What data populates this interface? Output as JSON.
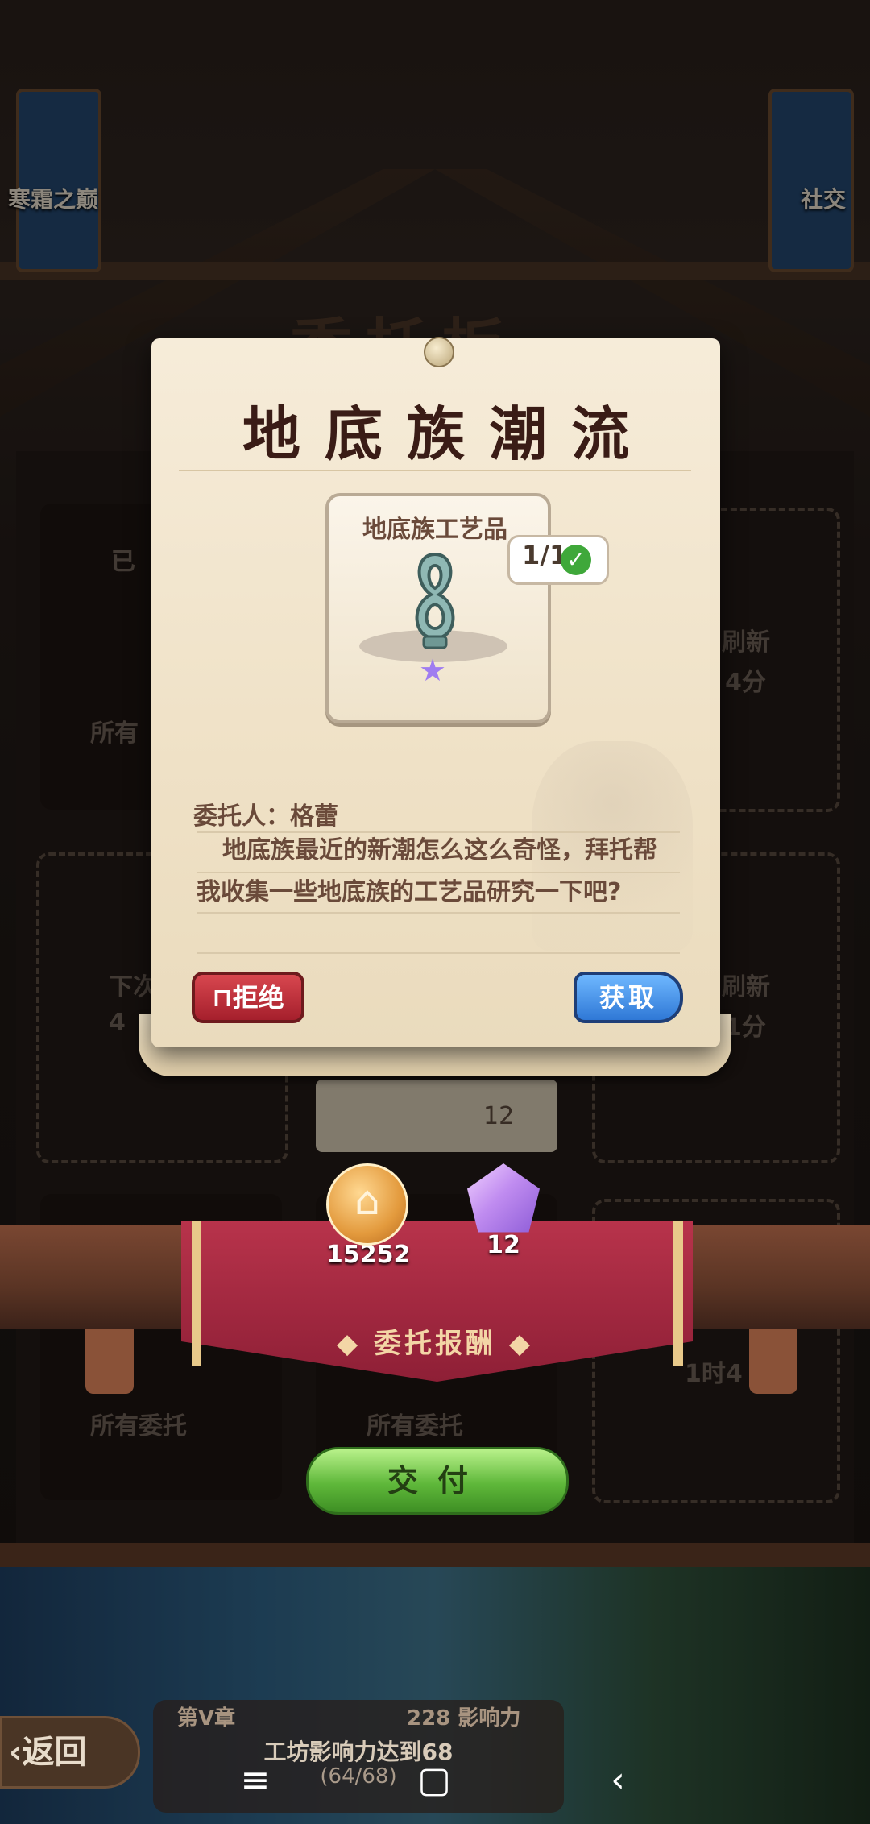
{
  "background": {
    "left_banner": "寒霜之巅",
    "right_banner": "社交",
    "title_partial": "委托板",
    "slot_texts": [
      "已",
      "所有",
      "刷新",
      "4分",
      "下次",
      "4",
      "刷新",
      "1分",
      "1时4",
      "所有委托",
      "所有委托"
    ],
    "card_value": "12"
  },
  "modal": {
    "title": "地底族潮流",
    "item_name": "地底族工艺品",
    "count": "1/1",
    "client": "委托人：格蕾",
    "description": "地底族最近的新潮怎么这么奇怪，拜托帮我收集一些地底族的工艺品研究一下吧?",
    "refuse_label": "拒绝",
    "obtain_label": "获取"
  },
  "rewards": {
    "label": "委托报酬",
    "items": [
      {
        "icon": "gold-coin-icon",
        "value": "15252"
      },
      {
        "icon": "purple-gem-icon",
        "value": "12"
      }
    ]
  },
  "deliver_label": "交付",
  "bottom": {
    "back_label": "返回",
    "chapter": "第V章",
    "influence": "228 影响力",
    "goal": "工坊影响力达到68",
    "progress": "(64/68)"
  },
  "colors": {
    "title": "#3a1c16",
    "refuse": "#c22f3b",
    "obtain": "#3b86e0",
    "deliver": "#6cc846",
    "cloth": "#a82a42"
  }
}
